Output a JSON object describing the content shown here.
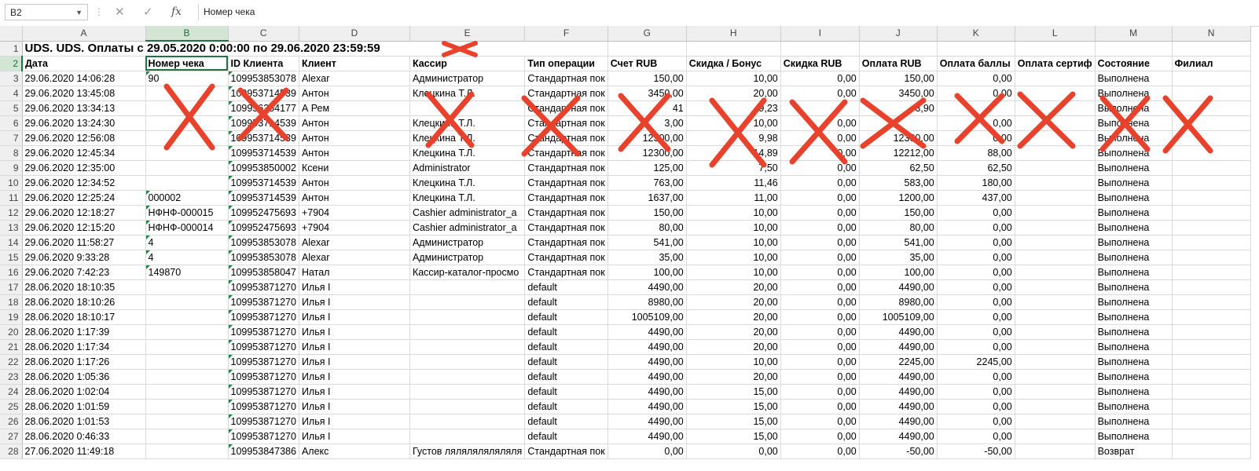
{
  "formula_bar": {
    "name_box": "B2",
    "cancel_icon": "✕",
    "enter_icon": "✓",
    "fx_label": "fx",
    "content": "Номер чека"
  },
  "columns": [
    "A",
    "B",
    "C",
    "D",
    "E",
    "F",
    "G",
    "H",
    "I",
    "J",
    "K",
    "L",
    "M",
    "N"
  ],
  "selected_cell": "B2",
  "title_row": {
    "row": 1,
    "text": "UDS. UDS. Оплаты с 29.05.2020 0:00:00 по 29.06.2020 23:59:59"
  },
  "headers": [
    "Дата",
    "Номер чека",
    "ID Клиента",
    "Клиент",
    "Кассир",
    "Тип операции",
    "Счет RUB",
    "Скидка / Бонус",
    "Скидка RUB",
    "Оплата RUB",
    "Оплата баллы",
    "Оплата сертиф",
    "Состояние",
    "Филиал"
  ],
  "rows": [
    {
      "n": 3,
      "c": [
        "29.06.2020 14:06:28",
        "90",
        "109953853078",
        "Alexar",
        "Администратор",
        "Стандартная пок",
        "150,00",
        "10,00",
        "0,00",
        "150,00",
        "0,00",
        "",
        "Выполнена",
        ""
      ]
    },
    {
      "n": 4,
      "c": [
        "29.06.2020 13:45:08",
        "",
        "109953714539",
        "Антон",
        "Клецкина Т.Л.",
        "Стандартная пок",
        "3450,00",
        "20,00",
        "0,00",
        "3450,00",
        "0,00",
        "",
        "Выполнена",
        ""
      ]
    },
    {
      "n": 5,
      "c": [
        "29.06.2020 13:34:13",
        "",
        "109956354177",
        "А Рем",
        "",
        "Стандартная пок",
        "41",
        "9,23",
        "",
        "3,90",
        "",
        "",
        "Выполнена",
        ""
      ]
    },
    {
      "n": 6,
      "c": [
        "29.06.2020 13:24:30",
        "",
        "109953714539",
        "Антон",
        "Клецкина Т.Л.",
        "Стандартная пок",
        "3,00",
        "10,00",
        "0,00",
        "",
        "0,00",
        "",
        "Выполнена",
        ""
      ]
    },
    {
      "n": 7,
      "c": [
        "29.06.2020 12:56:08",
        "",
        "109953714539",
        "Антон",
        "Клецкина Т.Л.",
        "Стандартная пок",
        "12300,00",
        "9,98",
        "0,00",
        "12300,00",
        "0,00",
        "",
        "Выполнена",
        ""
      ]
    },
    {
      "n": 8,
      "c": [
        "29.06.2020 12:45:34",
        "",
        "109953714539",
        "Антон",
        "Клецкина Т.Л.",
        "Стандартная пок",
        "12300,00",
        "14,89",
        "0,00",
        "12212,00",
        "88,00",
        "",
        "Выполнена",
        ""
      ]
    },
    {
      "n": 9,
      "c": [
        "29.06.2020 12:35:00",
        "",
        "109953850002",
        "Ксени",
        "Administrator",
        "Стандартная пок",
        "125,00",
        "7,50",
        "0,00",
        "62,50",
        "62,50",
        "",
        "Выполнена",
        ""
      ]
    },
    {
      "n": 10,
      "c": [
        "29.06.2020 12:34:52",
        "",
        "109953714539",
        "Антон",
        "Клецкина Т.Л.",
        "Стандартная пок",
        "763,00",
        "11,46",
        "0,00",
        "583,00",
        "180,00",
        "",
        "Выполнена",
        ""
      ]
    },
    {
      "n": 11,
      "c": [
        "29.06.2020 12:25:24",
        "000002",
        "109953714539",
        "Антон",
        "Клецкина Т.Л.",
        "Стандартная пок",
        "1637,00",
        "11,00",
        "0,00",
        "1200,00",
        "437,00",
        "",
        "Выполнена",
        ""
      ]
    },
    {
      "n": 12,
      "c": [
        "29.06.2020 12:18:27",
        "НФНФ-000015",
        "109952475693",
        "+7904",
        "Cashier administrator_a",
        "Стандартная пок",
        "150,00",
        "10,00",
        "0,00",
        "150,00",
        "0,00",
        "",
        "Выполнена",
        ""
      ]
    },
    {
      "n": 13,
      "c": [
        "29.06.2020 12:15:20",
        "НФНФ-000014",
        "109952475693",
        "+7904",
        "Cashier administrator_a",
        "Стандартная пок",
        "80,00",
        "10,00",
        "0,00",
        "80,00",
        "0,00",
        "",
        "Выполнена",
        ""
      ]
    },
    {
      "n": 14,
      "c": [
        "29.06.2020 11:58:27",
        "4",
        "109953853078",
        "Alexar",
        "Администратор",
        "Стандартная пок",
        "541,00",
        "10,00",
        "0,00",
        "541,00",
        "0,00",
        "",
        "Выполнена",
        ""
      ]
    },
    {
      "n": 15,
      "c": [
        "29.06.2020 9:33:28",
        "4",
        "109953853078",
        "Alexar",
        "Администратор",
        "Стандартная пок",
        "35,00",
        "10,00",
        "0,00",
        "35,00",
        "0,00",
        "",
        "Выполнена",
        ""
      ]
    },
    {
      "n": 16,
      "c": [
        "29.06.2020 7:42:23",
        "149870",
        "109953858047",
        "Натал",
        "Кассир-каталог-просмо",
        "Стандартная пок",
        "100,00",
        "10,00",
        "0,00",
        "100,00",
        "0,00",
        "",
        "Выполнена",
        ""
      ]
    },
    {
      "n": 17,
      "c": [
        "28.06.2020 18:10:35",
        "",
        "109953871270",
        "Илья I",
        "",
        "default",
        "4490,00",
        "20,00",
        "0,00",
        "4490,00",
        "0,00",
        "",
        "Выполнена",
        ""
      ]
    },
    {
      "n": 18,
      "c": [
        "28.06.2020 18:10:26",
        "",
        "109953871270",
        "Илья I",
        "",
        "default",
        "8980,00",
        "20,00",
        "0,00",
        "8980,00",
        "0,00",
        "",
        "Выполнена",
        ""
      ]
    },
    {
      "n": 19,
      "c": [
        "28.06.2020 18:10:17",
        "",
        "109953871270",
        "Илья I",
        "",
        "default",
        "1005109,00",
        "20,00",
        "0,00",
        "1005109,00",
        "0,00",
        "",
        "Выполнена",
        ""
      ]
    },
    {
      "n": 20,
      "c": [
        "28.06.2020 1:17:39",
        "",
        "109953871270",
        "Илья I",
        "",
        "default",
        "4490,00",
        "20,00",
        "0,00",
        "4490,00",
        "0,00",
        "",
        "Выполнена",
        ""
      ]
    },
    {
      "n": 21,
      "c": [
        "28.06.2020 1:17:34",
        "",
        "109953871270",
        "Илья I",
        "",
        "default",
        "4490,00",
        "20,00",
        "0,00",
        "4490,00",
        "0,00",
        "",
        "Выполнена",
        ""
      ]
    },
    {
      "n": 22,
      "c": [
        "28.06.2020 1:17:26",
        "",
        "109953871270",
        "Илья I",
        "",
        "default",
        "4490,00",
        "10,00",
        "0,00",
        "2245,00",
        "2245,00",
        "",
        "Выполнена",
        ""
      ]
    },
    {
      "n": 23,
      "c": [
        "28.06.2020 1:05:36",
        "",
        "109953871270",
        "Илья I",
        "",
        "default",
        "4490,00",
        "20,00",
        "0,00",
        "4490,00",
        "0,00",
        "",
        "Выполнена",
        ""
      ]
    },
    {
      "n": 24,
      "c": [
        "28.06.2020 1:02:04",
        "",
        "109953871270",
        "Илья I",
        "",
        "default",
        "4490,00",
        "15,00",
        "0,00",
        "4490,00",
        "0,00",
        "",
        "Выполнена",
        ""
      ]
    },
    {
      "n": 25,
      "c": [
        "28.06.2020 1:01:59",
        "",
        "109953871270",
        "Илья I",
        "",
        "default",
        "4490,00",
        "15,00",
        "0,00",
        "4490,00",
        "0,00",
        "",
        "Выполнена",
        ""
      ]
    },
    {
      "n": 26,
      "c": [
        "28.06.2020 1:01:53",
        "",
        "109953871270",
        "Илья I",
        "",
        "default",
        "4490,00",
        "15,00",
        "0,00",
        "4490,00",
        "0,00",
        "",
        "Выполнена",
        ""
      ]
    },
    {
      "n": 27,
      "c": [
        "28.06.2020 0:46:33",
        "",
        "109953871270",
        "Илья I",
        "",
        "default",
        "4490,00",
        "15,00",
        "0,00",
        "4490,00",
        "0,00",
        "",
        "Выполнена",
        ""
      ]
    },
    {
      "n": 28,
      "c": [
        "27.06.2020 11:49:18",
        "",
        "109953847386",
        "Алекс",
        "Густов ляляляляляляля",
        "Стандартная пок",
        "0,00",
        "0,00",
        "0,00",
        "-50,00",
        "-50,00",
        "",
        "Возврат",
        ""
      ]
    }
  ],
  "annotation_color": "#e8412c"
}
